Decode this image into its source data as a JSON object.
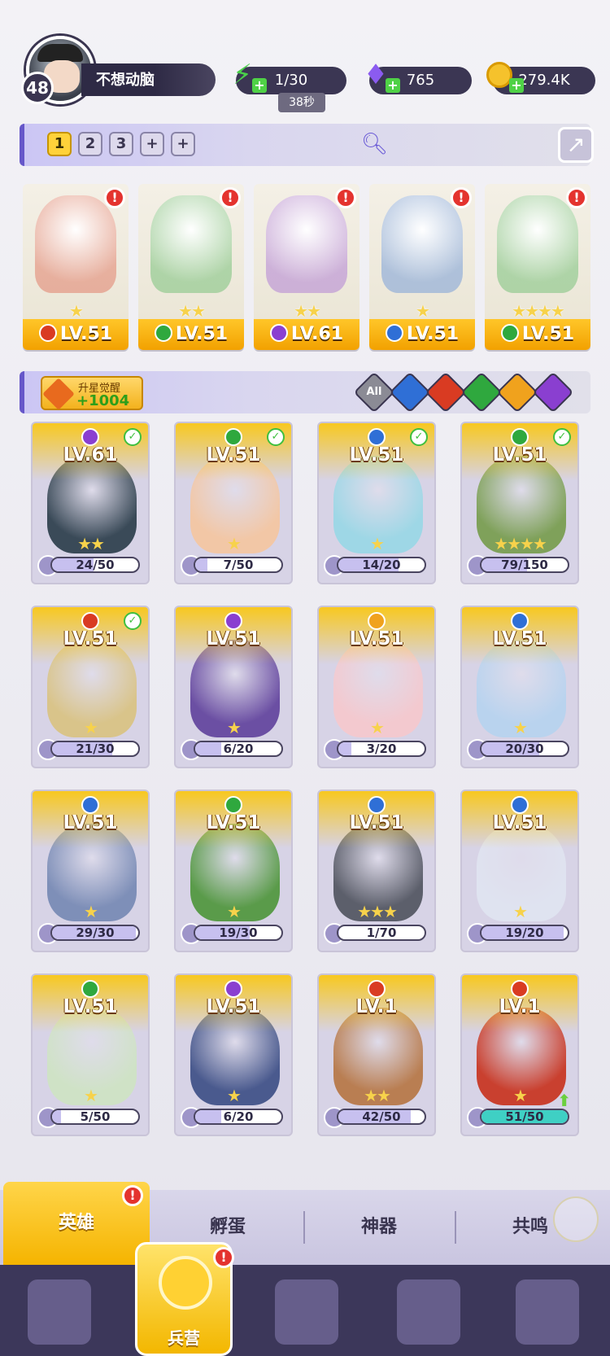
{
  "player": {
    "level": "48",
    "name": "不想动脑"
  },
  "resources": {
    "energy": {
      "value": "1/30",
      "timer": "38秒",
      "icon": "lightning-icon"
    },
    "gems": {
      "value": "765",
      "icon": "diamond-icon"
    },
    "coins": {
      "value": "279.4K",
      "icon": "coin-icon"
    }
  },
  "team_tabs": [
    "1",
    "2",
    "3",
    "+",
    "+"
  ],
  "team": [
    {
      "level": "LV.51",
      "element": "fire",
      "stars": 1,
      "alert": "!"
    },
    {
      "level": "LV.51",
      "element": "nature",
      "stars": 2,
      "alert": "!"
    },
    {
      "level": "LV.61",
      "element": "shadow",
      "stars": 2,
      "alert": "!"
    },
    {
      "level": "LV.51",
      "element": "water",
      "stars": 1,
      "alert": "!"
    },
    {
      "level": "LV.51",
      "element": "nature",
      "stars": 4,
      "alert": "!"
    }
  ],
  "awaken": {
    "label": "升星觉醒",
    "value": "+1004"
  },
  "filters": [
    {
      "label": "All",
      "color": "#8b8b95"
    },
    {
      "label": "",
      "color": "#2f6fd6",
      "name": "water"
    },
    {
      "label": "",
      "color": "#d93b22",
      "name": "fire"
    },
    {
      "label": "",
      "color": "#2fa83e",
      "name": "nature"
    },
    {
      "label": "",
      "color": "#f0a21d",
      "name": "light"
    },
    {
      "label": "",
      "color": "#8a3fd0",
      "name": "shadow"
    }
  ],
  "heroes": [
    {
      "level": "LV.61",
      "element": "shadow",
      "progress": "24/50",
      "ratio": 0.48,
      "stars": 2,
      "check": true,
      "art": "#3a4a58"
    },
    {
      "level": "LV.51",
      "element": "nature",
      "progress": "7/50",
      "ratio": 0.14,
      "stars": 1,
      "check": true,
      "art": "#f2c7a6"
    },
    {
      "level": "LV.51",
      "element": "water",
      "progress": "14/20",
      "ratio": 0.7,
      "stars": 1,
      "check": true,
      "art": "#9ed7e6"
    },
    {
      "level": "LV.51",
      "element": "nature",
      "progress": "79/150",
      "ratio": 0.53,
      "stars": 4,
      "check": true,
      "art": "#7fa15a"
    },
    {
      "level": "LV.51",
      "element": "fire",
      "progress": "21/30",
      "ratio": 0.7,
      "stars": 1,
      "check": true,
      "art": "#d9c48a"
    },
    {
      "level": "LV.51",
      "element": "shadow",
      "progress": "6/20",
      "ratio": 0.3,
      "stars": 1,
      "check": false,
      "art": "#6b4fa3"
    },
    {
      "level": "LV.51",
      "element": "light",
      "progress": "3/20",
      "ratio": 0.15,
      "stars": 1,
      "check": false,
      "art": "#f3c9cf"
    },
    {
      "level": "LV.51",
      "element": "water",
      "progress": "20/30",
      "ratio": 0.67,
      "stars": 1,
      "check": false,
      "art": "#b9d3ee"
    },
    {
      "level": "LV.51",
      "element": "water",
      "progress": "29/30",
      "ratio": 0.97,
      "stars": 1,
      "check": false,
      "art": "#7e8fb8"
    },
    {
      "level": "LV.51",
      "element": "nature",
      "progress": "19/30",
      "ratio": 0.63,
      "stars": 1,
      "check": false,
      "art": "#5a9b4a"
    },
    {
      "level": "LV.51",
      "element": "water",
      "progress": "1/70",
      "ratio": 0.01,
      "stars": 3,
      "check": false,
      "art": "#5c5f6b"
    },
    {
      "level": "LV.51",
      "element": "water",
      "progress": "19/20",
      "ratio": 0.95,
      "stars": 1,
      "check": false,
      "art": "#dfe3f0"
    },
    {
      "level": "LV.51",
      "element": "nature",
      "progress": "5/50",
      "ratio": 0.1,
      "stars": 1,
      "check": false,
      "art": "#cfe2c6"
    },
    {
      "level": "LV.51",
      "element": "shadow",
      "progress": "6/20",
      "ratio": 0.3,
      "stars": 1,
      "check": false,
      "art": "#4a5a8e"
    },
    {
      "level": "LV.1",
      "element": "fire",
      "progress": "42/50",
      "ratio": 0.84,
      "stars": 2,
      "check": false,
      "art": "#b97e52"
    },
    {
      "level": "LV.1",
      "element": "fire",
      "progress": "51/50",
      "ratio": 1.0,
      "stars": 1,
      "check": false,
      "art": "#c9402f",
      "upgrade": true
    }
  ],
  "subtabs": [
    "英雄",
    "孵蛋",
    "神器",
    "共鸣"
  ],
  "subtab_alert": "!",
  "nav": {
    "barracks": "兵营",
    "alert": "!"
  },
  "element_colors": {
    "fire": "#d93b22",
    "nature": "#2fa83e",
    "water": "#2f6fd6",
    "shadow": "#8a3fd0",
    "light": "#f0a21d"
  }
}
